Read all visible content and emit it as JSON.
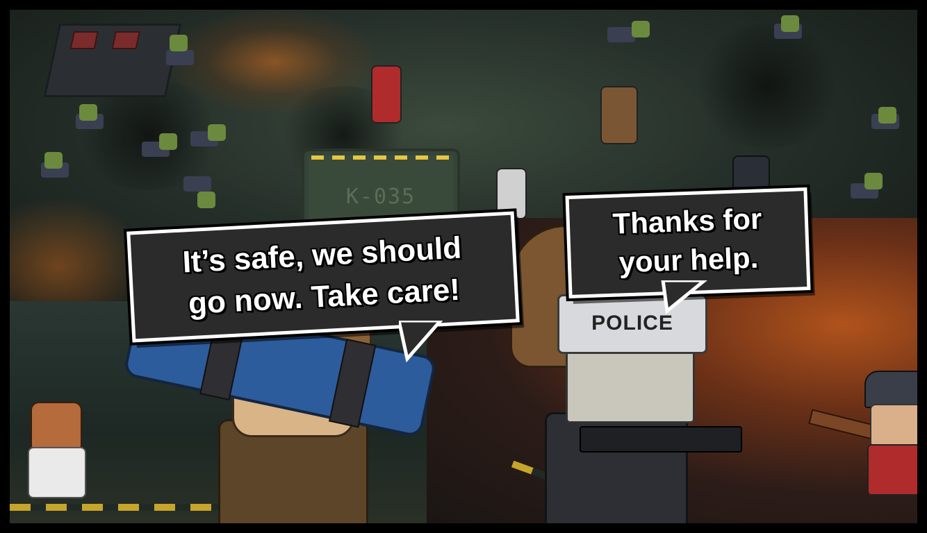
{
  "dialogue": {
    "left_speaker_line": "It’s safe, we should go now. Take care!",
    "left_line_1": "It’s safe, we should",
    "left_line_2": "go now. Take care!",
    "right_line_1": "Thanks for",
    "right_line_2": "your help."
  },
  "scene": {
    "hatch_label": "K-035",
    "police_label": "POLICE"
  },
  "colors": {
    "bubble_fill": "#2b2b2b",
    "bubble_border": "#ffffff",
    "hazard_yellow": "#c7a52a",
    "explosion_orange": "#d66e1e"
  }
}
